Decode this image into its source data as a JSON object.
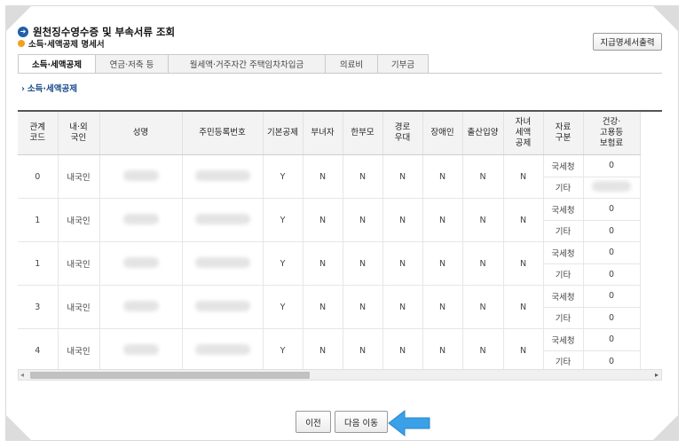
{
  "header": {
    "title": "원천징수영수증 및 부속서류 조회",
    "subtitle": "소득·세액공제 명세서",
    "print_button": "지급명세서출력"
  },
  "tabs": [
    {
      "label": "소득·세액공제",
      "active": true
    },
    {
      "label": "연금·저축 등",
      "active": false
    },
    {
      "label": "월세액·거주자간 주택임차차입금",
      "active": false
    },
    {
      "label": "의료비",
      "active": false
    },
    {
      "label": "기부금",
      "active": false
    }
  ],
  "section_label": "소득·세액공제",
  "table": {
    "headers": {
      "relation_code": [
        "관계",
        "코드"
      ],
      "nationality": [
        "내·외",
        "국인"
      ],
      "name": "성명",
      "rrn": "주민등록번호",
      "basic_deduction": "기본공제",
      "female_head": "부녀자",
      "single_parent": "한부모",
      "elderly": [
        "경로",
        "우대"
      ],
      "disabled": "장애인",
      "birth_adoption": "출산입양",
      "child_tax_credit": [
        "자녀",
        "세액",
        "공제"
      ],
      "source_type": [
        "자료",
        "구분"
      ],
      "insurance": [
        "건강·",
        "고용등",
        "보험료"
      ]
    },
    "rows": [
      {
        "relation_code": "0",
        "nationality": "내국인",
        "basic_deduction": "Y",
        "female_head": "N",
        "single_parent": "N",
        "elderly": "N",
        "disabled": "N",
        "birth_adoption": "N",
        "child_tax_credit": "N",
        "sub": [
          {
            "source": "국세청",
            "insurance": "0"
          },
          {
            "source": "기타",
            "insurance": ""
          }
        ]
      },
      {
        "relation_code": "1",
        "nationality": "내국인",
        "basic_deduction": "Y",
        "female_head": "N",
        "single_parent": "N",
        "elderly": "N",
        "disabled": "N",
        "birth_adoption": "N",
        "child_tax_credit": "N",
        "sub": [
          {
            "source": "국세청",
            "insurance": "0"
          },
          {
            "source": "기타",
            "insurance": "0"
          }
        ]
      },
      {
        "relation_code": "1",
        "nationality": "내국인",
        "basic_deduction": "Y",
        "female_head": "N",
        "single_parent": "N",
        "elderly": "N",
        "disabled": "N",
        "birth_adoption": "N",
        "child_tax_credit": "N",
        "sub": [
          {
            "source": "국세청",
            "insurance": "0"
          },
          {
            "source": "기타",
            "insurance": "0"
          }
        ]
      },
      {
        "relation_code": "3",
        "nationality": "내국인",
        "basic_deduction": "Y",
        "female_head": "N",
        "single_parent": "N",
        "elderly": "N",
        "disabled": "N",
        "birth_adoption": "N",
        "child_tax_credit": "N",
        "sub": [
          {
            "source": "국세청",
            "insurance": "0"
          },
          {
            "source": "기타",
            "insurance": "0"
          }
        ]
      },
      {
        "relation_code": "4",
        "nationality": "내국인",
        "basic_deduction": "Y",
        "female_head": "N",
        "single_parent": "N",
        "elderly": "N",
        "disabled": "N",
        "birth_adoption": "N",
        "child_tax_credit": "N",
        "sub": [
          {
            "source": "국세청",
            "insurance": "0"
          },
          {
            "source": "기타",
            "insurance": "0"
          }
        ]
      }
    ]
  },
  "footer": {
    "prev_button": "이전",
    "next_button": "다음 이동"
  },
  "colors": {
    "accent_blue": "#1f5fa8",
    "pointer_blue": "#3aa0e8",
    "bullet_orange": "#f0a020"
  }
}
